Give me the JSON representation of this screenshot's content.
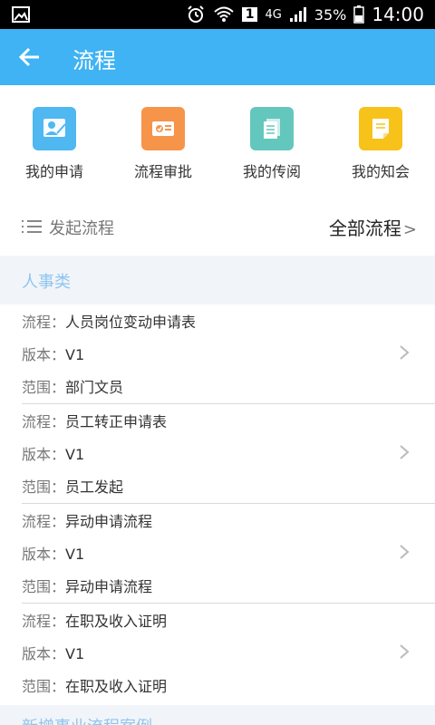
{
  "status_bar": {
    "network": "4G",
    "sim_slot": "1",
    "battery": "35%",
    "time": "14:00"
  },
  "app_bar": {
    "title": "流程",
    "back_icon": "arrow-left-icon"
  },
  "quick_actions": [
    {
      "label": "我的申请",
      "icon": "user-sign-icon",
      "color": "#4fb8f1"
    },
    {
      "label": "流程审批",
      "icon": "approval-card-icon",
      "color": "#f6944a"
    },
    {
      "label": "我的传阅",
      "icon": "documents-icon",
      "color": "#63c7bd"
    },
    {
      "label": "我的知会",
      "icon": "notice-icon",
      "color": "#f7c21a"
    }
  ],
  "launch_section": {
    "title": "发起流程",
    "all_link": "全部流程"
  },
  "category": {
    "name": "人事类",
    "color": "#8fc5ef"
  },
  "field_labels": {
    "process": "流程：",
    "version": "版本：",
    "scope": "范围："
  },
  "processes": [
    {
      "name": "人员岗位变动申请表",
      "version": "V1",
      "scope": "部门文员"
    },
    {
      "name": "员工转正申请表",
      "version": "V1",
      "scope": "员工发起"
    },
    {
      "name": "异动申请流程",
      "version": "V1",
      "scope": "异动申请流程"
    },
    {
      "name": "在职及收入证明",
      "version": "V1",
      "scope": "在职及收入证明"
    }
  ],
  "next_category": {
    "name": "新增事业流程案例"
  }
}
